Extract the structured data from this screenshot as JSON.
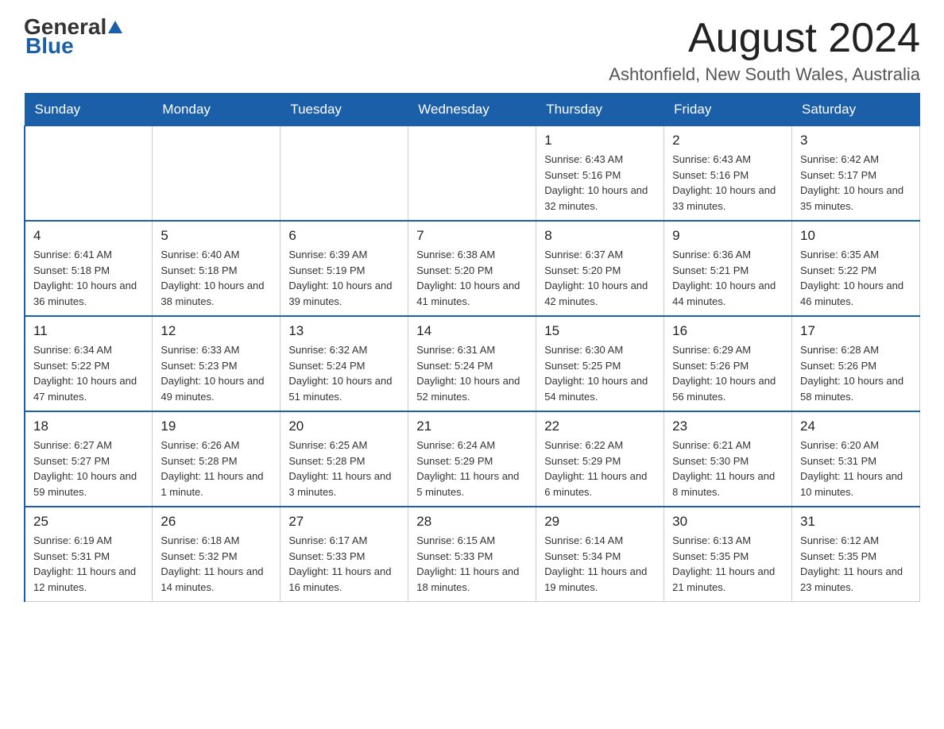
{
  "header": {
    "logo_general": "General",
    "logo_blue": "Blue",
    "title": "August 2024",
    "subtitle": "Ashtonfield, New South Wales, Australia"
  },
  "days_of_week": [
    "Sunday",
    "Monday",
    "Tuesday",
    "Wednesday",
    "Thursday",
    "Friday",
    "Saturday"
  ],
  "weeks": [
    [
      {
        "day": "",
        "info": ""
      },
      {
        "day": "",
        "info": ""
      },
      {
        "day": "",
        "info": ""
      },
      {
        "day": "",
        "info": ""
      },
      {
        "day": "1",
        "info": "Sunrise: 6:43 AM\nSunset: 5:16 PM\nDaylight: 10 hours and 32 minutes."
      },
      {
        "day": "2",
        "info": "Sunrise: 6:43 AM\nSunset: 5:16 PM\nDaylight: 10 hours and 33 minutes."
      },
      {
        "day": "3",
        "info": "Sunrise: 6:42 AM\nSunset: 5:17 PM\nDaylight: 10 hours and 35 minutes."
      }
    ],
    [
      {
        "day": "4",
        "info": "Sunrise: 6:41 AM\nSunset: 5:18 PM\nDaylight: 10 hours and 36 minutes."
      },
      {
        "day": "5",
        "info": "Sunrise: 6:40 AM\nSunset: 5:18 PM\nDaylight: 10 hours and 38 minutes."
      },
      {
        "day": "6",
        "info": "Sunrise: 6:39 AM\nSunset: 5:19 PM\nDaylight: 10 hours and 39 minutes."
      },
      {
        "day": "7",
        "info": "Sunrise: 6:38 AM\nSunset: 5:20 PM\nDaylight: 10 hours and 41 minutes."
      },
      {
        "day": "8",
        "info": "Sunrise: 6:37 AM\nSunset: 5:20 PM\nDaylight: 10 hours and 42 minutes."
      },
      {
        "day": "9",
        "info": "Sunrise: 6:36 AM\nSunset: 5:21 PM\nDaylight: 10 hours and 44 minutes."
      },
      {
        "day": "10",
        "info": "Sunrise: 6:35 AM\nSunset: 5:22 PM\nDaylight: 10 hours and 46 minutes."
      }
    ],
    [
      {
        "day": "11",
        "info": "Sunrise: 6:34 AM\nSunset: 5:22 PM\nDaylight: 10 hours and 47 minutes."
      },
      {
        "day": "12",
        "info": "Sunrise: 6:33 AM\nSunset: 5:23 PM\nDaylight: 10 hours and 49 minutes."
      },
      {
        "day": "13",
        "info": "Sunrise: 6:32 AM\nSunset: 5:24 PM\nDaylight: 10 hours and 51 minutes."
      },
      {
        "day": "14",
        "info": "Sunrise: 6:31 AM\nSunset: 5:24 PM\nDaylight: 10 hours and 52 minutes."
      },
      {
        "day": "15",
        "info": "Sunrise: 6:30 AM\nSunset: 5:25 PM\nDaylight: 10 hours and 54 minutes."
      },
      {
        "day": "16",
        "info": "Sunrise: 6:29 AM\nSunset: 5:26 PM\nDaylight: 10 hours and 56 minutes."
      },
      {
        "day": "17",
        "info": "Sunrise: 6:28 AM\nSunset: 5:26 PM\nDaylight: 10 hours and 58 minutes."
      }
    ],
    [
      {
        "day": "18",
        "info": "Sunrise: 6:27 AM\nSunset: 5:27 PM\nDaylight: 10 hours and 59 minutes."
      },
      {
        "day": "19",
        "info": "Sunrise: 6:26 AM\nSunset: 5:28 PM\nDaylight: 11 hours and 1 minute."
      },
      {
        "day": "20",
        "info": "Sunrise: 6:25 AM\nSunset: 5:28 PM\nDaylight: 11 hours and 3 minutes."
      },
      {
        "day": "21",
        "info": "Sunrise: 6:24 AM\nSunset: 5:29 PM\nDaylight: 11 hours and 5 minutes."
      },
      {
        "day": "22",
        "info": "Sunrise: 6:22 AM\nSunset: 5:29 PM\nDaylight: 11 hours and 6 minutes."
      },
      {
        "day": "23",
        "info": "Sunrise: 6:21 AM\nSunset: 5:30 PM\nDaylight: 11 hours and 8 minutes."
      },
      {
        "day": "24",
        "info": "Sunrise: 6:20 AM\nSunset: 5:31 PM\nDaylight: 11 hours and 10 minutes."
      }
    ],
    [
      {
        "day": "25",
        "info": "Sunrise: 6:19 AM\nSunset: 5:31 PM\nDaylight: 11 hours and 12 minutes."
      },
      {
        "day": "26",
        "info": "Sunrise: 6:18 AM\nSunset: 5:32 PM\nDaylight: 11 hours and 14 minutes."
      },
      {
        "day": "27",
        "info": "Sunrise: 6:17 AM\nSunset: 5:33 PM\nDaylight: 11 hours and 16 minutes."
      },
      {
        "day": "28",
        "info": "Sunrise: 6:15 AM\nSunset: 5:33 PM\nDaylight: 11 hours and 18 minutes."
      },
      {
        "day": "29",
        "info": "Sunrise: 6:14 AM\nSunset: 5:34 PM\nDaylight: 11 hours and 19 minutes."
      },
      {
        "day": "30",
        "info": "Sunrise: 6:13 AM\nSunset: 5:35 PM\nDaylight: 11 hours and 21 minutes."
      },
      {
        "day": "31",
        "info": "Sunrise: 6:12 AM\nSunset: 5:35 PM\nDaylight: 11 hours and 23 minutes."
      }
    ]
  ]
}
